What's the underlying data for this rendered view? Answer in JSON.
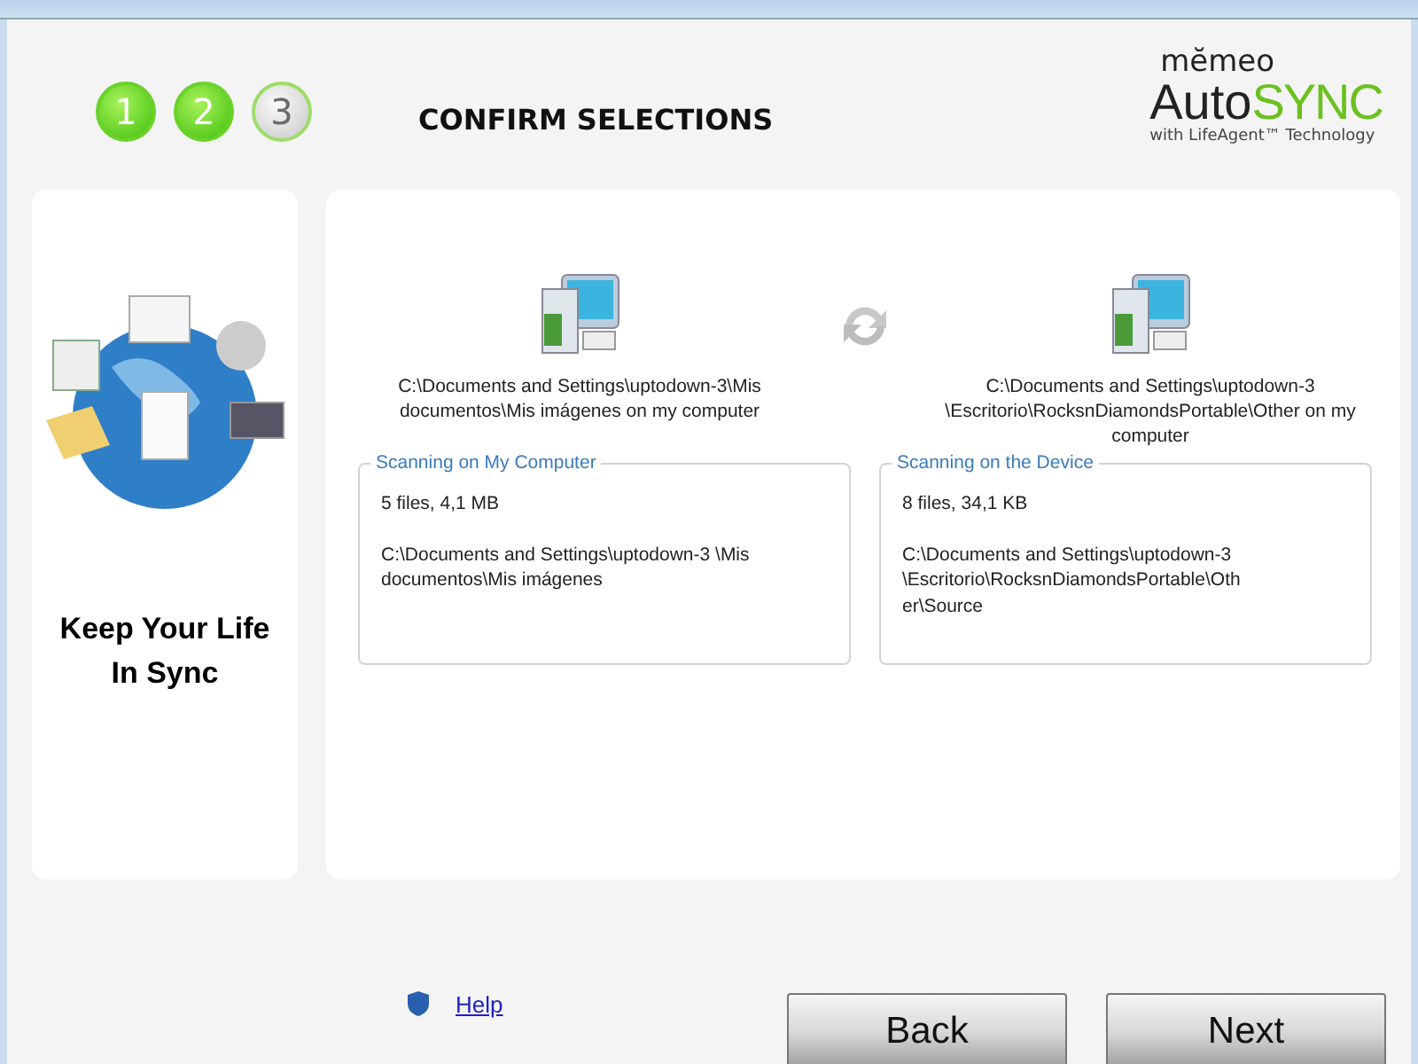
{
  "steps": [
    {
      "label": "1",
      "completed": true
    },
    {
      "label": "2",
      "completed": true
    },
    {
      "label": "3",
      "completed": false
    }
  ],
  "heading": "CONFIRM SELECTIONS",
  "logo": {
    "brand": "mĕmeo",
    "auto": "Auto",
    "sync": "SYNC",
    "tagline": "with LifeAgent™ Technology"
  },
  "side_panel": {
    "slogan": "Keep Your Life In Sync"
  },
  "source": {
    "path": "C:\\Documents and Settings\\uptodown-3\\Mis documentos\\Mis imágenes on my computer",
    "group_title": "Scanning on My Computer",
    "summary": "5 files, 4,1 MB",
    "scan_path": "C:\\Documents and Settings\\uptodown-3 \\Mis documentos\\Mis imágenes"
  },
  "target": {
    "path": "C:\\Documents and Settings\\uptodown-3 \\Escritorio\\RocksnDiamondsPortable\\Other on my computer",
    "group_title": "Scanning on the Device",
    "summary": "8 files, 34,1 KB",
    "scan_path": "C:\\Documents and Settings\\uptodown-3 \\Escritorio\\RocksnDiamondsPortable\\Oth er\\Source"
  },
  "help_link": "Help",
  "buttons": [
    "Back",
    "Next"
  ]
}
